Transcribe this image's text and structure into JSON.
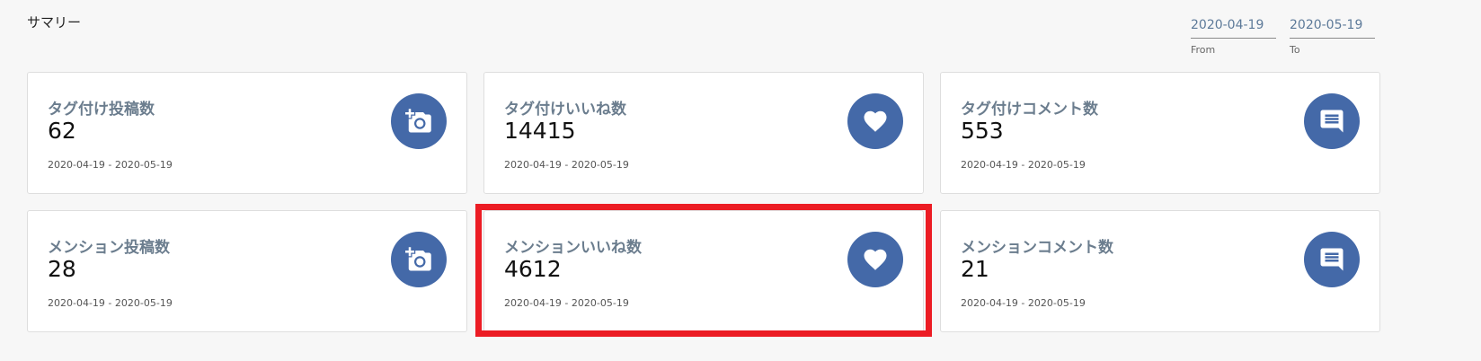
{
  "summary": {
    "title": "サマリー"
  },
  "date_range": {
    "from_value": "2020-04-19",
    "from_label": "From",
    "to_value": "2020-05-19",
    "to_label": "To"
  },
  "cards": [
    {
      "title": "タグ付け投稿数",
      "value": "62",
      "range": "2020-04-19 - 2020-05-19",
      "icon": "add-photo-icon"
    },
    {
      "title": "タグ付けいいね数",
      "value": "14415",
      "range": "2020-04-19 - 2020-05-19",
      "icon": "heart-icon"
    },
    {
      "title": "タグ付けコメント数",
      "value": "553",
      "range": "2020-04-19 - 2020-05-19",
      "icon": "comment-icon"
    },
    {
      "title": "メンション投稿数",
      "value": "28",
      "range": "2020-04-19 - 2020-05-19",
      "icon": "add-photo-icon"
    },
    {
      "title": "メンションいいね数",
      "value": "4612",
      "range": "2020-04-19 - 2020-05-19",
      "icon": "heart-icon"
    },
    {
      "title": "メンションコメント数",
      "value": "21",
      "range": "2020-04-19 - 2020-05-19",
      "icon": "comment-icon"
    }
  ],
  "colors": {
    "icon_background": "#4469a8",
    "highlight": "#ec1c24",
    "card_title": "#6b7d8e"
  }
}
